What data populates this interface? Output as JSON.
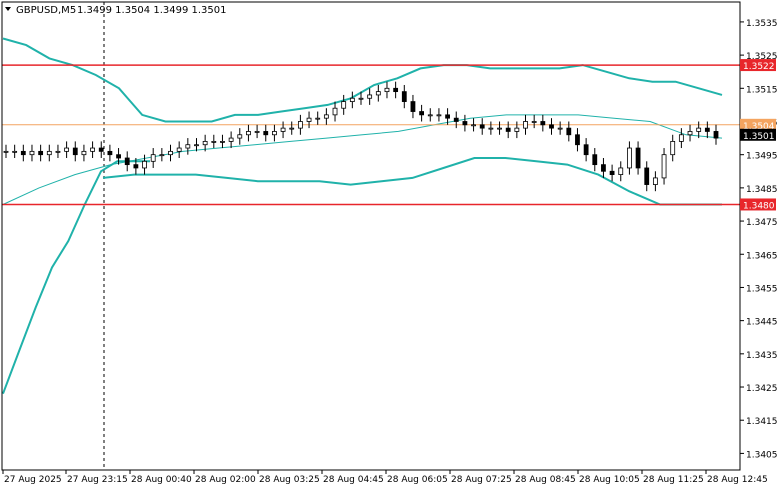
{
  "header": {
    "symbol_timeframe": "GBPUSD,M5",
    "ohlc": "1.3499 1.3504 1.3499 1.3501",
    "menu_icon": "triangle-down-icon"
  },
  "colors": {
    "background": "#ffffff",
    "candle": "#000000",
    "bands": "#20b2aa",
    "moving_average": "#20b2aa",
    "horizontal_lines": "#e8262b",
    "bid_line": "#f4a460",
    "bid_label_bg": "#000000",
    "vertical_marker": "#000000"
  },
  "chart_data": {
    "type": "candlestick",
    "symbol": "GBPUSD",
    "timeframe": "M5",
    "y_ticks": [
      "1.3535",
      "1.3525",
      "1.3515",
      "1.3505",
      "1.3495",
      "1.3485",
      "1.3475",
      "1.3465",
      "1.3455",
      "1.3445",
      "1.3435",
      "1.3425",
      "1.3415",
      "1.3405"
    ],
    "x_ticks": [
      "27 Aug 2025",
      "27 Aug 23:15",
      "28 Aug 00:40",
      "28 Aug 02:00",
      "28 Aug 03:25",
      "28 Aug 04:45",
      "28 Aug 06:05",
      "28 Aug 07:25",
      "28 Aug 08:45",
      "28 Aug 10:05",
      "28 Aug 11:25",
      "28 Aug 12:45"
    ],
    "ylim": [
      1.34,
      1.3541
    ],
    "horizontal_levels": [
      {
        "value": 1.3522,
        "label": "1.3522",
        "kind": "resistance"
      },
      {
        "value": 1.348,
        "label": "1.3480",
        "kind": "support"
      },
      {
        "value": 1.3504,
        "label": "1.3504",
        "kind": "ask"
      }
    ],
    "current_price": {
      "value": 1.3501,
      "label": "1.3501"
    },
    "candle_closes": [
      1.3496,
      1.3496,
      1.3495,
      1.3496,
      1.3495,
      1.3496,
      1.3496,
      1.3497,
      1.3495,
      1.3496,
      1.3497,
      1.3496,
      1.3495,
      1.3494,
      1.3492,
      1.3491,
      1.3493,
      1.3495,
      1.3495,
      1.3496,
      1.3497,
      1.3498,
      1.3498,
      1.3499,
      1.3499,
      1.3499,
      1.35,
      1.3501,
      1.3502,
      1.3502,
      1.3501,
      1.3502,
      1.3503,
      1.3503,
      1.3505,
      1.3506,
      1.3506,
      1.3507,
      1.3509,
      1.3511,
      1.3512,
      1.3512,
      1.3513,
      1.3514,
      1.3515,
      1.3514,
      1.3511,
      1.3508,
      1.3507,
      1.3507,
      1.3507,
      1.3506,
      1.3505,
      1.3504,
      1.3504,
      1.3503,
      1.3503,
      1.3503,
      1.3502,
      1.3503,
      1.3505,
      1.3505,
      1.3504,
      1.3503,
      1.3503,
      1.3501,
      1.3498,
      1.3495,
      1.3492,
      1.349,
      1.3489,
      1.3491,
      1.3497,
      1.3491,
      1.3486,
      1.3488,
      1.3495,
      1.3499,
      1.3501,
      1.3502,
      1.3503,
      1.3502,
      1.35
    ],
    "upper_band": [
      1.353,
      1.3528,
      1.3524,
      1.3522,
      1.3519,
      1.3515,
      1.3507,
      1.3505,
      1.3505,
      1.3505,
      1.3507,
      1.3507,
      1.3508,
      1.3509,
      1.351,
      1.3512,
      1.3516,
      1.3518,
      1.3521,
      1.3522,
      1.3522,
      1.3521,
      1.3521,
      1.3521,
      1.3521,
      1.3522,
      1.352,
      1.3518,
      1.3517,
      1.3517,
      1.3515,
      1.3513
    ],
    "lower_band": [
      1.3488,
      1.3489,
      1.3489,
      1.3489,
      1.3488,
      1.3487,
      1.3487,
      1.3487,
      1.3486,
      1.3487,
      1.3488,
      1.3491,
      1.3494,
      1.3494,
      1.3493,
      1.3492,
      1.3489,
      1.3484,
      1.348,
      1.348,
      1.348
    ],
    "moving_average": [
      1.348,
      1.3485,
      1.3489,
      1.3492,
      1.3494,
      1.3496,
      1.3497,
      1.3498,
      1.3499,
      1.35,
      1.3501,
      1.3502,
      1.3504,
      1.3506,
      1.3507,
      1.3507,
      1.3507,
      1.3506,
      1.3505,
      1.3501,
      1.35
    ],
    "long_ma": [
      1.3423,
      1.3436,
      1.3449,
      1.3461,
      1.3469,
      1.348,
      1.349,
      1.3493,
      1.3493,
      1.3493
    ]
  }
}
